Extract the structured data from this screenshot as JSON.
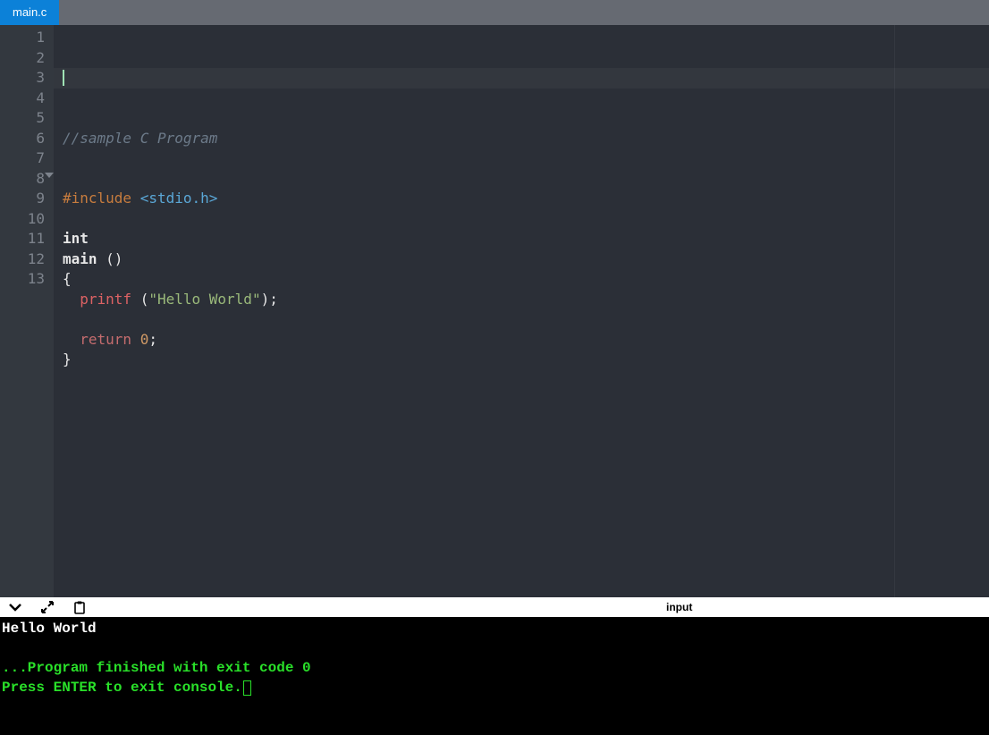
{
  "tab": {
    "name": "main.c"
  },
  "editor": {
    "currentLine": 3,
    "lines": [
      {
        "n": 1,
        "tokens": [
          {
            "cls": "c-comment",
            "t": "//sample C Program"
          }
        ]
      },
      {
        "n": 2,
        "tokens": []
      },
      {
        "n": 3,
        "tokens": []
      },
      {
        "n": 4,
        "tokens": [
          {
            "cls": "c-pre",
            "t": "#include "
          },
          {
            "cls": "c-inc",
            "t": "<stdio.h>"
          }
        ]
      },
      {
        "n": 5,
        "tokens": []
      },
      {
        "n": 6,
        "tokens": [
          {
            "cls": "c-kw",
            "t": "int"
          }
        ]
      },
      {
        "n": 7,
        "tokens": [
          {
            "cls": "c-kw",
            "t": "main "
          },
          {
            "cls": "c-plain",
            "t": "()"
          }
        ]
      },
      {
        "n": 8,
        "tokens": [
          {
            "cls": "c-plain",
            "t": "{"
          }
        ]
      },
      {
        "n": 9,
        "tokens": [
          {
            "cls": "c-plain",
            "t": "  "
          },
          {
            "cls": "c-fn",
            "t": "printf "
          },
          {
            "cls": "c-plain",
            "t": "("
          },
          {
            "cls": "c-str",
            "t": "\"Hello World\""
          },
          {
            "cls": "c-plain",
            "t": ");"
          }
        ]
      },
      {
        "n": 10,
        "tokens": []
      },
      {
        "n": 11,
        "tokens": [
          {
            "cls": "c-plain",
            "t": "  "
          },
          {
            "cls": "c-ret",
            "t": "return "
          },
          {
            "cls": "c-num",
            "t": "0"
          },
          {
            "cls": "c-plain",
            "t": ";"
          }
        ]
      },
      {
        "n": 12,
        "tokens": [
          {
            "cls": "c-plain",
            "t": "}"
          }
        ]
      },
      {
        "n": 13,
        "tokens": []
      }
    ]
  },
  "toolbar": {
    "input_label": "input"
  },
  "console": {
    "output": "Hello World",
    "finished": "...Program finished with exit code 0",
    "prompt": "Press ENTER to exit console."
  }
}
